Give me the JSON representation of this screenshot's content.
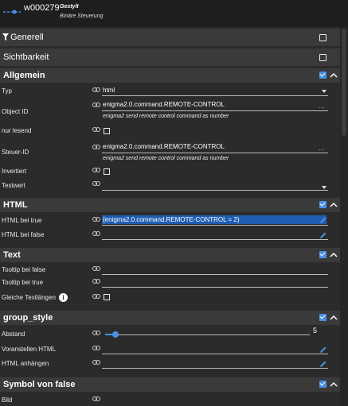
{
  "widget": {
    "id": "w000279",
    "style": "Gestylt",
    "set": "Binäre Steuerung"
  },
  "bars": {
    "generell": "Generell",
    "sichtbarkeit": "Sichtbarkeit"
  },
  "allgemein": {
    "title": "Allgemein",
    "typ_label": "Typ",
    "typ_value": "html",
    "oid_label": "Object ID",
    "oid_value": "enigma2.0.command.REMOTE-CONTROL",
    "oid_hint": "enigma2 send remote control command as number",
    "readonly_label": "nur lesend",
    "steuer_label": "Steuer-ID",
    "steuer_value": "enigma2.0.command.REMOTE-CONTROL",
    "steuer_hint": "enigma2 send remote control command as number",
    "invert_label": "Invertiert",
    "test_label": "Testwert",
    "dots": "..."
  },
  "html": {
    "title": "HTML",
    "true_label": "HTML bei true",
    "true_value": "{enigma2.0.command.REMOTE-CONTROL = 2}",
    "false_label": "HTML bei false"
  },
  "text": {
    "title": "Text",
    "tt_false": "Tooltip bei false",
    "tt_true": "Tooltip bei true",
    "equal": "Gleiche Textlängen",
    "info": "i"
  },
  "group_style": {
    "title": "group_style",
    "abstand_label": "Abstand",
    "abstand_value": "5",
    "abstand_fraction": 0.05,
    "prepend_label": "Voranstellen HTML",
    "append_label": "HTML anhängen"
  },
  "symbol_false": {
    "title": "Symbol von false",
    "bild_label": "Bild"
  },
  "colors": {
    "accent": "#4a90e2",
    "panel": "#2b2b2b",
    "header": "#3a3a3a"
  }
}
